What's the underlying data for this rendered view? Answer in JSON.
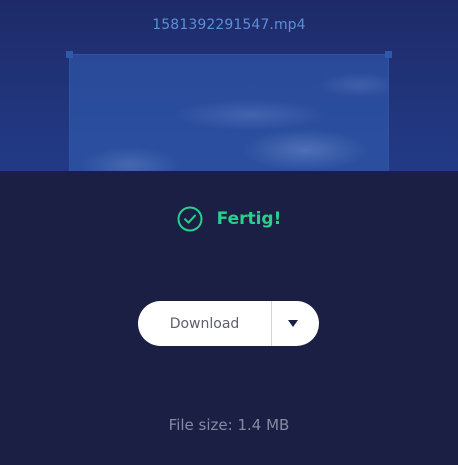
{
  "file": {
    "name": "1581392291547.mp4"
  },
  "status": {
    "text": "Fertig!",
    "icon": "check-circle-icon",
    "color": "#27d08c"
  },
  "actions": {
    "download_label": "Download",
    "dropdown_icon": "caret-down-icon"
  },
  "file_info": {
    "size_text": "File size: 1.4 MB"
  },
  "colors": {
    "background": "#1b1f43",
    "accent": "#27d08c",
    "filename": "#5b8fd6"
  }
}
